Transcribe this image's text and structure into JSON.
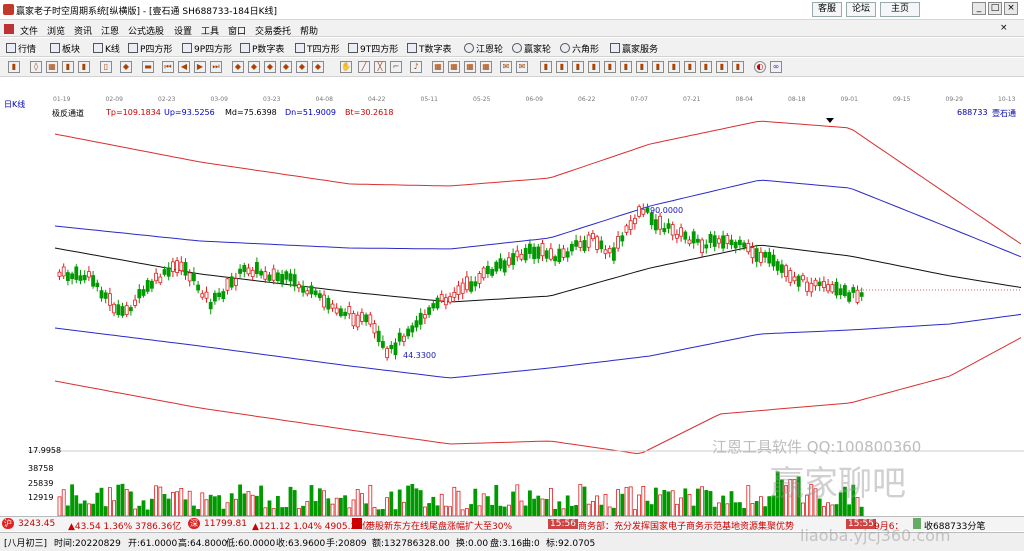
{
  "window": {
    "title": "赢家老子时空周期系统[纵横版] - [壹石通  SH688733-184日K线]",
    "buttons": [
      "客服",
      "论坛",
      "主页"
    ]
  },
  "menu": [
    "文件",
    "浏览",
    "资讯",
    "江恩",
    "公式选股",
    "设置",
    "工具",
    "窗口",
    "交易委托",
    "帮助"
  ],
  "toolbar": [
    "行情",
    "板块",
    "K线",
    "P四方形",
    "9P四方形",
    "P数字表",
    "T四方形",
    "9T四方形",
    "T数字表",
    "江恩轮",
    "赢家轮",
    "六角形",
    "赢家服务"
  ],
  "chart_header": {
    "period": "日K线",
    "indicator": "极反通道",
    "tp": "Tp=109.1834",
    "up": "Up=93.5256",
    "md": "Md=75.6398",
    "dn": "Dn=51.9009",
    "bt": "Bt=30.2618",
    "code": "688733",
    "name": "壹石通"
  },
  "dates": [
    "01-19",
    "02-09",
    "02-23",
    "03-09",
    "03-23",
    "04-08",
    "04-22",
    "05-11",
    "05-25",
    "06-09",
    "06-22",
    "07-07",
    "07-21",
    "08-04",
    "08-18",
    "09-01",
    "09-15",
    "09-29",
    "10-13"
  ],
  "chart_data": {
    "type": "candlestick",
    "title": "",
    "xlabel": "",
    "ylabel": "",
    "annotations": {
      "high": "90.0000",
      "low": "44.3300"
    },
    "volume_ticks": [
      "17.9958",
      "38758",
      "25839",
      "12919"
    ],
    "colors": {
      "up": "#e02020",
      "down": "#009a00",
      "outer_band": "#d93030",
      "inner_band": "#2a2ac8",
      "mid_line": "#111111",
      "label": "#1a1ab0"
    }
  },
  "watermark": {
    "line1": "江恩工具软件   QQ:100800360",
    "line2": "赢家聊吧",
    "line3": "liaoba.yjcj360.com"
  },
  "ticker": {
    "idx1": "3243.45",
    "idx1_chg": "▲43.54 1.36% 3786.36亿",
    "idx2": "11799.81",
    "idx2_chg": "▲121.12 1.04% 4905.21亿",
    "news1": "港股新东方在线尾盘涨幅扩大至30%",
    "t1": "15:56",
    "news2": "商务部：充分发挥国家电子商务示范基地资源集聚优势",
    "t2": "15:55",
    "news3": "9月6：",
    "right": "收688733分笔"
  },
  "status": {
    "lunar": "[八月初三]",
    "time": "时间:20220829",
    "open": "开:61.0000",
    "high": "高:64.8000",
    "low": "低:60.0000",
    "close": "收:63.9600",
    "hand": "手:20809",
    "amount": "额:132786328.00",
    "chg": "换:0.00",
    "ampl": "盘:3.16",
    "q": "曲:0",
    "ratio": "标:92.0705"
  }
}
